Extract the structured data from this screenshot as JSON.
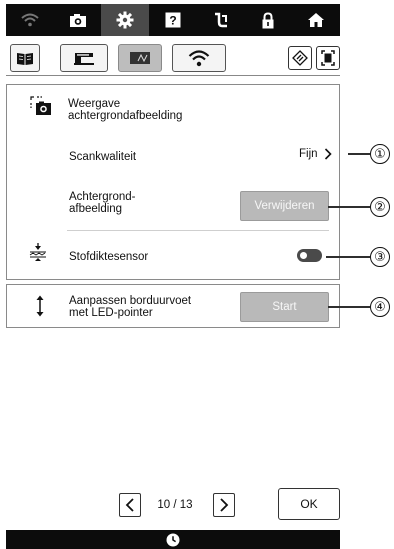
{
  "topbar": {
    "icons": [
      "wifi-icon",
      "camera-icon",
      "gear-icon",
      "help-icon",
      "needle-icon",
      "lock-icon",
      "home-icon"
    ],
    "active_index": 2
  },
  "tabs": {
    "icons": [
      "book-icon",
      "sewing-machine-icon",
      "embroidery-frame-icon",
      "wifi-icon"
    ],
    "selected_index": 2,
    "right_icons": [
      "reset-icon",
      "frame-size-icon"
    ]
  },
  "settings": {
    "background_image": {
      "title": "Weergave achtergrondafbeelding",
      "scan_quality_label": "Scankwaliteit",
      "scan_quality_value": "Fijn",
      "background_label": "Achtergrond-\nafbeelding",
      "delete_button": "Verwijderen"
    },
    "fabric_sensor": {
      "label": "Stofdiktesensor",
      "enabled": false
    },
    "led_pointer": {
      "label": "Aanpassen borduurvoet\nmet LED-pointer",
      "start_button": "Start"
    }
  },
  "callouts": [
    "①",
    "②",
    "③",
    "④"
  ],
  "pagination": {
    "page": "10 / 13",
    "ok_label": "OK"
  },
  "colors": {
    "topbar": "#0c0c0c",
    "disabled_button": "#b9b9b9",
    "toggle_off": "#4a4a4a"
  }
}
